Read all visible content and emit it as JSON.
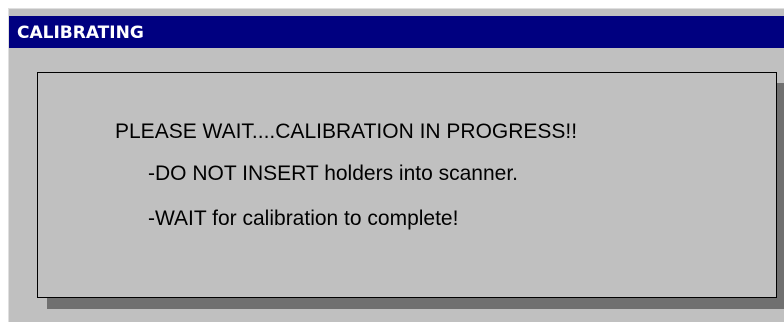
{
  "window": {
    "title": "CALIBRATING"
  },
  "message": {
    "headline": "PLEASE WAIT....CALIBRATION IN PROGRESS!!",
    "instructions": [
      "-DO NOT INSERT holders into scanner.",
      "-WAIT for calibration to complete!"
    ]
  },
  "colors": {
    "titlebar": "#000080",
    "title_text": "#ffffff",
    "window_background": "#c0c0c0",
    "panel_shadow": "#707070"
  }
}
